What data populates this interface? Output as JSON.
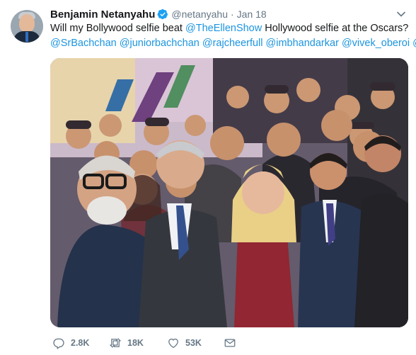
{
  "tweet": {
    "author_name": "Benjamin Netanyahu",
    "author_handle": "@netanyahu",
    "separator": "·",
    "time": "Jan 18",
    "text_line1_plain1": "Will my Bollywood selfie beat ",
    "mention_ellen": "@TheEllenShow",
    "text_line1_plain2": " Hollywood selfie at the Oscars?",
    "mentions_line2": [
      "@SrBachchan",
      "@juniorbachchan",
      "@rajcheerfull",
      "@imbhandarkar",
      "@vivek_oberoi",
      "@"
    ],
    "image_alt": "Group selfie photo"
  },
  "actions": {
    "reply_count": "2.8K",
    "retweet_count": "18K",
    "like_count": "53K"
  },
  "icons": {
    "verified": "verified-badge-icon",
    "caret": "chevron-down-icon",
    "reply": "reply-icon",
    "retweet": "retweet-icon",
    "like": "heart-icon",
    "message": "direct-message-icon"
  },
  "colors": {
    "link": "#1b95e0",
    "secondary_text": "#657786",
    "verified": "#1da1f2"
  }
}
